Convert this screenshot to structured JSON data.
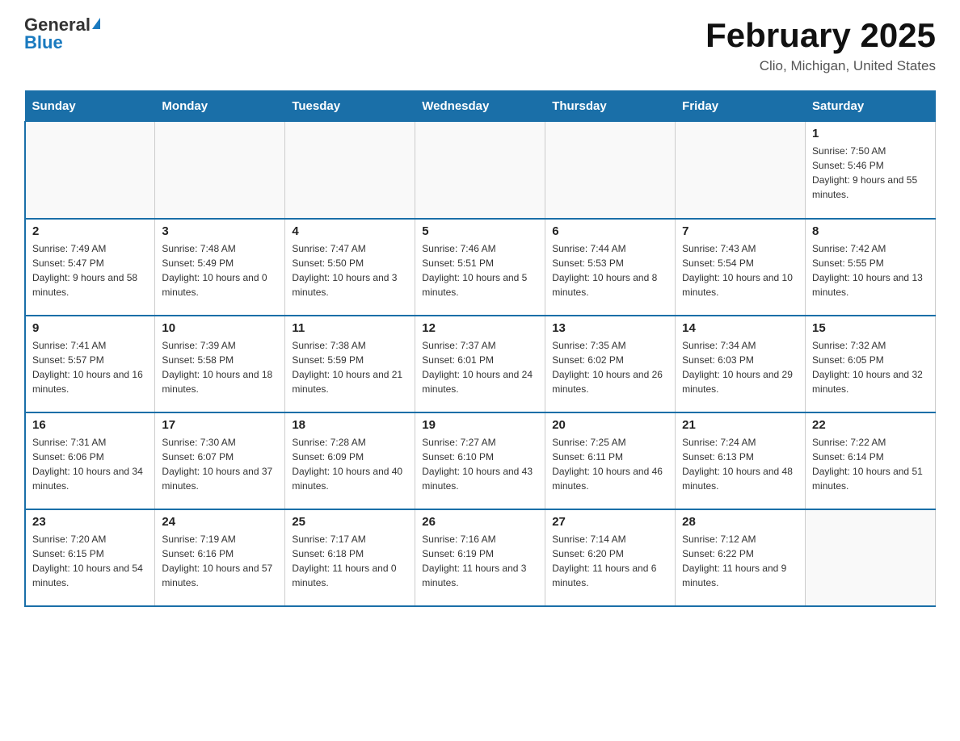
{
  "header": {
    "logo_general": "General",
    "logo_blue": "Blue",
    "title": "February 2025",
    "subtitle": "Clio, Michigan, United States"
  },
  "days_of_week": [
    "Sunday",
    "Monday",
    "Tuesday",
    "Wednesday",
    "Thursday",
    "Friday",
    "Saturday"
  ],
  "weeks": [
    [
      {
        "day": "",
        "sunrise": "",
        "sunset": "",
        "daylight": ""
      },
      {
        "day": "",
        "sunrise": "",
        "sunset": "",
        "daylight": ""
      },
      {
        "day": "",
        "sunrise": "",
        "sunset": "",
        "daylight": ""
      },
      {
        "day": "",
        "sunrise": "",
        "sunset": "",
        "daylight": ""
      },
      {
        "day": "",
        "sunrise": "",
        "sunset": "",
        "daylight": ""
      },
      {
        "day": "",
        "sunrise": "",
        "sunset": "",
        "daylight": ""
      },
      {
        "day": "1",
        "sunrise": "Sunrise: 7:50 AM",
        "sunset": "Sunset: 5:46 PM",
        "daylight": "Daylight: 9 hours and 55 minutes."
      }
    ],
    [
      {
        "day": "2",
        "sunrise": "Sunrise: 7:49 AM",
        "sunset": "Sunset: 5:47 PM",
        "daylight": "Daylight: 9 hours and 58 minutes."
      },
      {
        "day": "3",
        "sunrise": "Sunrise: 7:48 AM",
        "sunset": "Sunset: 5:49 PM",
        "daylight": "Daylight: 10 hours and 0 minutes."
      },
      {
        "day": "4",
        "sunrise": "Sunrise: 7:47 AM",
        "sunset": "Sunset: 5:50 PM",
        "daylight": "Daylight: 10 hours and 3 minutes."
      },
      {
        "day": "5",
        "sunrise": "Sunrise: 7:46 AM",
        "sunset": "Sunset: 5:51 PM",
        "daylight": "Daylight: 10 hours and 5 minutes."
      },
      {
        "day": "6",
        "sunrise": "Sunrise: 7:44 AM",
        "sunset": "Sunset: 5:53 PM",
        "daylight": "Daylight: 10 hours and 8 minutes."
      },
      {
        "day": "7",
        "sunrise": "Sunrise: 7:43 AM",
        "sunset": "Sunset: 5:54 PM",
        "daylight": "Daylight: 10 hours and 10 minutes."
      },
      {
        "day": "8",
        "sunrise": "Sunrise: 7:42 AM",
        "sunset": "Sunset: 5:55 PM",
        "daylight": "Daylight: 10 hours and 13 minutes."
      }
    ],
    [
      {
        "day": "9",
        "sunrise": "Sunrise: 7:41 AM",
        "sunset": "Sunset: 5:57 PM",
        "daylight": "Daylight: 10 hours and 16 minutes."
      },
      {
        "day": "10",
        "sunrise": "Sunrise: 7:39 AM",
        "sunset": "Sunset: 5:58 PM",
        "daylight": "Daylight: 10 hours and 18 minutes."
      },
      {
        "day": "11",
        "sunrise": "Sunrise: 7:38 AM",
        "sunset": "Sunset: 5:59 PM",
        "daylight": "Daylight: 10 hours and 21 minutes."
      },
      {
        "day": "12",
        "sunrise": "Sunrise: 7:37 AM",
        "sunset": "Sunset: 6:01 PM",
        "daylight": "Daylight: 10 hours and 24 minutes."
      },
      {
        "day": "13",
        "sunrise": "Sunrise: 7:35 AM",
        "sunset": "Sunset: 6:02 PM",
        "daylight": "Daylight: 10 hours and 26 minutes."
      },
      {
        "day": "14",
        "sunrise": "Sunrise: 7:34 AM",
        "sunset": "Sunset: 6:03 PM",
        "daylight": "Daylight: 10 hours and 29 minutes."
      },
      {
        "day": "15",
        "sunrise": "Sunrise: 7:32 AM",
        "sunset": "Sunset: 6:05 PM",
        "daylight": "Daylight: 10 hours and 32 minutes."
      }
    ],
    [
      {
        "day": "16",
        "sunrise": "Sunrise: 7:31 AM",
        "sunset": "Sunset: 6:06 PM",
        "daylight": "Daylight: 10 hours and 34 minutes."
      },
      {
        "day": "17",
        "sunrise": "Sunrise: 7:30 AM",
        "sunset": "Sunset: 6:07 PM",
        "daylight": "Daylight: 10 hours and 37 minutes."
      },
      {
        "day": "18",
        "sunrise": "Sunrise: 7:28 AM",
        "sunset": "Sunset: 6:09 PM",
        "daylight": "Daylight: 10 hours and 40 minutes."
      },
      {
        "day": "19",
        "sunrise": "Sunrise: 7:27 AM",
        "sunset": "Sunset: 6:10 PM",
        "daylight": "Daylight: 10 hours and 43 minutes."
      },
      {
        "day": "20",
        "sunrise": "Sunrise: 7:25 AM",
        "sunset": "Sunset: 6:11 PM",
        "daylight": "Daylight: 10 hours and 46 minutes."
      },
      {
        "day": "21",
        "sunrise": "Sunrise: 7:24 AM",
        "sunset": "Sunset: 6:13 PM",
        "daylight": "Daylight: 10 hours and 48 minutes."
      },
      {
        "day": "22",
        "sunrise": "Sunrise: 7:22 AM",
        "sunset": "Sunset: 6:14 PM",
        "daylight": "Daylight: 10 hours and 51 minutes."
      }
    ],
    [
      {
        "day": "23",
        "sunrise": "Sunrise: 7:20 AM",
        "sunset": "Sunset: 6:15 PM",
        "daylight": "Daylight: 10 hours and 54 minutes."
      },
      {
        "day": "24",
        "sunrise": "Sunrise: 7:19 AM",
        "sunset": "Sunset: 6:16 PM",
        "daylight": "Daylight: 10 hours and 57 minutes."
      },
      {
        "day": "25",
        "sunrise": "Sunrise: 7:17 AM",
        "sunset": "Sunset: 6:18 PM",
        "daylight": "Daylight: 11 hours and 0 minutes."
      },
      {
        "day": "26",
        "sunrise": "Sunrise: 7:16 AM",
        "sunset": "Sunset: 6:19 PM",
        "daylight": "Daylight: 11 hours and 3 minutes."
      },
      {
        "day": "27",
        "sunrise": "Sunrise: 7:14 AM",
        "sunset": "Sunset: 6:20 PM",
        "daylight": "Daylight: 11 hours and 6 minutes."
      },
      {
        "day": "28",
        "sunrise": "Sunrise: 7:12 AM",
        "sunset": "Sunset: 6:22 PM",
        "daylight": "Daylight: 11 hours and 9 minutes."
      },
      {
        "day": "",
        "sunrise": "",
        "sunset": "",
        "daylight": ""
      }
    ]
  ]
}
